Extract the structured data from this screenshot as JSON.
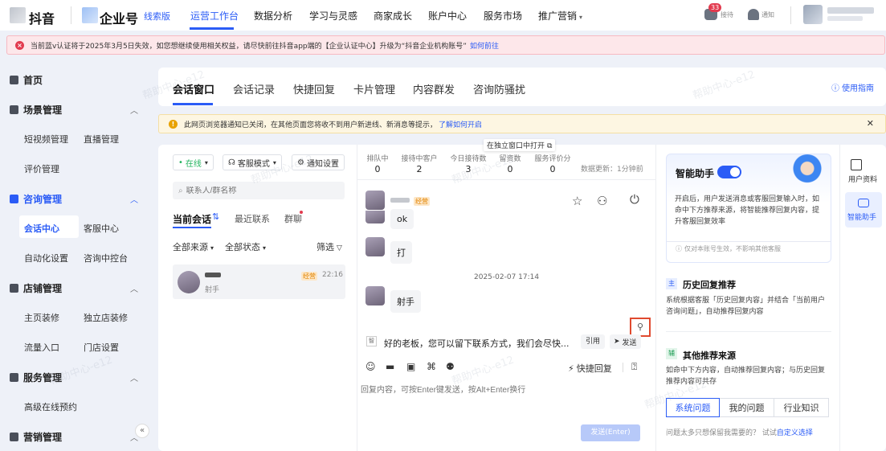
{
  "topbar": {
    "brand": "抖音",
    "enterprise": "企业号",
    "edition": "线索版",
    "nav": [
      "运营工作台",
      "数据分析",
      "学习与灵感",
      "商家成长",
      "账户中心",
      "服务市场",
      "推广营销"
    ],
    "msg_count": "33",
    "msg_label": "接待",
    "notify_label": "通知"
  },
  "alert": {
    "text": "当前蓝v认证将于2025年3月5日失效，如您想继续使用相关权益，请尽快前往抖音app端的【企业认证中心】升级为“抖音企业机构账号”",
    "link": "如何前往"
  },
  "sidebar": {
    "home": "首页",
    "groups": [
      {
        "label": "场景管理",
        "items": [
          "短视频管理",
          "直播管理",
          "评价管理"
        ]
      },
      {
        "label": "咨询管理",
        "items": [
          "会话中心",
          "客服中心",
          "自动化设置",
          "咨询中控台"
        ]
      },
      {
        "label": "店铺管理",
        "items": [
          "主页装修",
          "独立店装修",
          "流量入口",
          "门店设置"
        ]
      },
      {
        "label": "服务管理",
        "items": [
          "高级在线预约"
        ]
      },
      {
        "label": "营销管理",
        "items": []
      }
    ]
  },
  "main_tabs": [
    "会话窗口",
    "会话记录",
    "快捷回复",
    "卡片管理",
    "内容群发",
    "咨询防骚扰"
  ],
  "guide_link": "使用指南",
  "warning": {
    "text": "此网页浏览器通知已关闭，在其他页面您将收不到用户新进线、新消息等提示，",
    "link": "了解如何开启"
  },
  "left_panel": {
    "status": "在线",
    "mode": "客服模式",
    "notify": "通知设置",
    "search_placeholder": "联系人/群名称",
    "tabs": [
      "当前会话",
      "最近联系",
      "群聊"
    ],
    "filter_source": "全部来源",
    "filter_status": "全部状态",
    "filter": "筛选",
    "conv": {
      "name": "",
      "tag": "经营",
      "time": "22:16",
      "preview": "射手"
    }
  },
  "stats": [
    {
      "label": "排队中",
      "value": "0"
    },
    {
      "label": "接待中客户",
      "value": "2"
    },
    {
      "label": "今日接待数",
      "value": "3"
    },
    {
      "label": "留资数",
      "value": "0"
    },
    {
      "label": "服务评价分",
      "value": "0"
    }
  ],
  "updated": "数据更新：1分钟前",
  "open_independent": "在独立窗口中打开",
  "chat": {
    "user_tag": "经营",
    "messages": [
      "ok",
      "打",
      "射手"
    ],
    "time_sep": "2025-02-07 17:14"
  },
  "suggest": {
    "icon": "智",
    "text": "好的老板，您可以留下联系方式，我们会尽快...",
    "quote": "引用",
    "send": "发送"
  },
  "toolbar": {
    "quick_reply": "快捷回复"
  },
  "reply_placeholder": "回复内容，可按Enter键发送，按Alt+Enter换行",
  "send_button": "发送(Enter)",
  "assistant": {
    "title": "智能助手",
    "desc": "开启后，用户发送消息或客服回复输入时，如命中下方推荐来源，将智能推荐回复内容，提升客服回复效率",
    "note": "仅对本账号生效，不影响其他客服",
    "history_title": "历史回复推荐",
    "history_icon": "主",
    "history_desc": "系统根据客服「历史回复内容」并结合「当前用户咨询问题」，自动推荐回复内容",
    "other_title": "其他推荐来源",
    "other_icon": "辅",
    "other_desc": "如命中下方内容，自动推荐回复内容；与历史回复推荐内容可共存",
    "segs": [
      "系统问题",
      "我的问题",
      "行业知识"
    ],
    "bottom": "问题太多只想保留我需要的？ 试试",
    "bottom_link": "自定义选择"
  },
  "right_rail": [
    "用户资料",
    "智能助手"
  ],
  "watermark": "帮助中心-e12",
  "colors": {
    "accent": "#2b5cf6",
    "error": "#e23b4f",
    "warning": "#e8a200"
  }
}
